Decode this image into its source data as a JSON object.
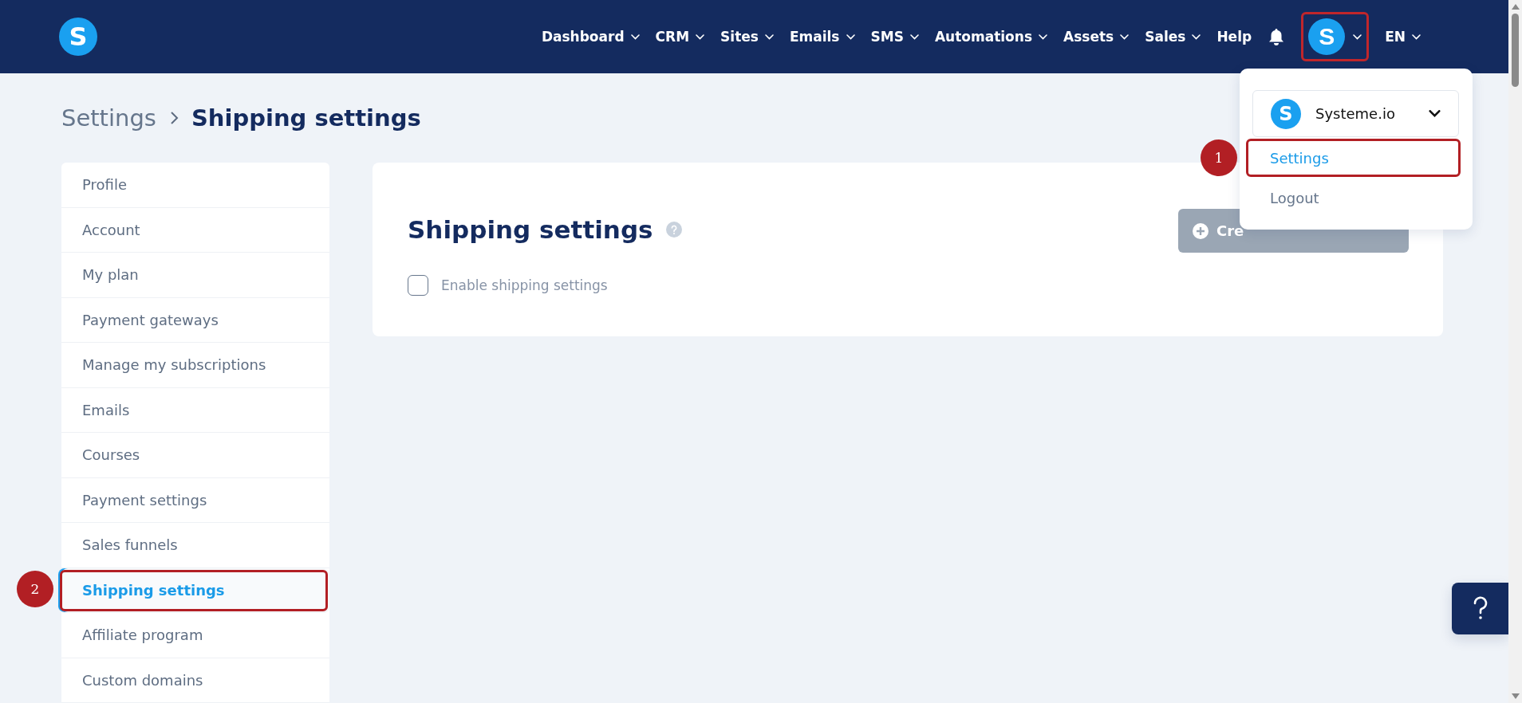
{
  "navbar": {
    "logo": {
      "letter": "S"
    },
    "items": [
      {
        "label": "Dashboard",
        "has_menu": true
      },
      {
        "label": "CRM",
        "has_menu": true
      },
      {
        "label": "Sites",
        "has_menu": true
      },
      {
        "label": "Emails",
        "has_menu": true
      },
      {
        "label": "SMS",
        "has_menu": true
      },
      {
        "label": "Automations",
        "has_menu": true
      },
      {
        "label": "Assets",
        "has_menu": true
      },
      {
        "label": "Sales",
        "has_menu": true
      },
      {
        "label": "Help",
        "has_menu": false
      }
    ],
    "avatar": {
      "letter": "S",
      "highlighted": true
    },
    "language": {
      "label": "EN"
    }
  },
  "breadcrumb": [
    {
      "label": "Settings",
      "current": false
    },
    {
      "label": "Shipping settings",
      "current": true
    }
  ],
  "sidebar": {
    "items": [
      {
        "label": "Profile",
        "selected": false,
        "highlighted": false
      },
      {
        "label": "Account",
        "selected": false,
        "highlighted": false
      },
      {
        "label": "My plan",
        "selected": false,
        "highlighted": false
      },
      {
        "label": "Payment gateways",
        "selected": false,
        "highlighted": false
      },
      {
        "label": "Manage my subscriptions",
        "selected": false,
        "highlighted": false
      },
      {
        "label": "Emails",
        "selected": false,
        "highlighted": false
      },
      {
        "label": "Courses",
        "selected": false,
        "highlighted": false
      },
      {
        "label": "Payment settings",
        "selected": false,
        "highlighted": false
      },
      {
        "label": "Sales funnels",
        "selected": false,
        "highlighted": false
      },
      {
        "label": "Shipping settings",
        "selected": true,
        "highlighted": true
      },
      {
        "label": "Affiliate program",
        "selected": false,
        "highlighted": false
      },
      {
        "label": "Custom domains",
        "selected": false,
        "highlighted": false
      }
    ]
  },
  "card": {
    "title": "Shipping settings",
    "create_button": {
      "label": "Cre",
      "disabled": true
    },
    "checkbox": {
      "label": "Enable shipping settings",
      "checked": false
    }
  },
  "account_menu": {
    "account": {
      "letter": "S",
      "name": "Systeme.io"
    },
    "items": [
      {
        "label": "Settings",
        "highlighted": true
      },
      {
        "label": "Logout",
        "highlighted": false
      }
    ]
  },
  "annotations": [
    {
      "number": "1"
    },
    {
      "number": "2"
    }
  ]
}
